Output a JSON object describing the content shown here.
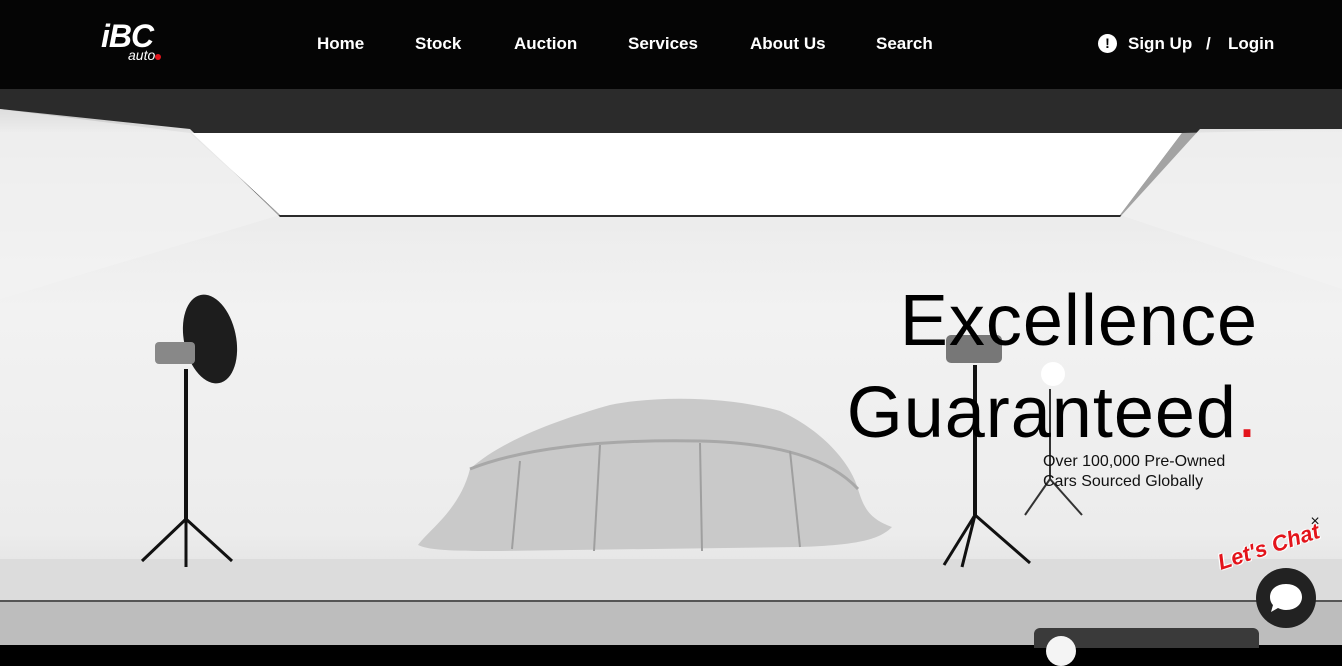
{
  "logo": {
    "brand": "iBC",
    "sub": "auto"
  },
  "nav": {
    "items": [
      {
        "label": "Home"
      },
      {
        "label": "Stock"
      },
      {
        "label": "Auction"
      },
      {
        "label": "Services"
      },
      {
        "label": "About Us"
      },
      {
        "label": "Search"
      }
    ],
    "signup": "Sign Up",
    "separator": "/",
    "login": "Login",
    "alert_icon": "!"
  },
  "hero": {
    "line1": "Excellence",
    "line2": "Guaranteed",
    "dot": ".",
    "sub_line1": "Over 100,000 Pre-Owned",
    "sub_line2": "Cars Sourced Globally"
  },
  "chat": {
    "label": "Let's Chat",
    "close": "×"
  },
  "colors": {
    "accent": "#e3141b",
    "nav_bg": "#050505"
  }
}
